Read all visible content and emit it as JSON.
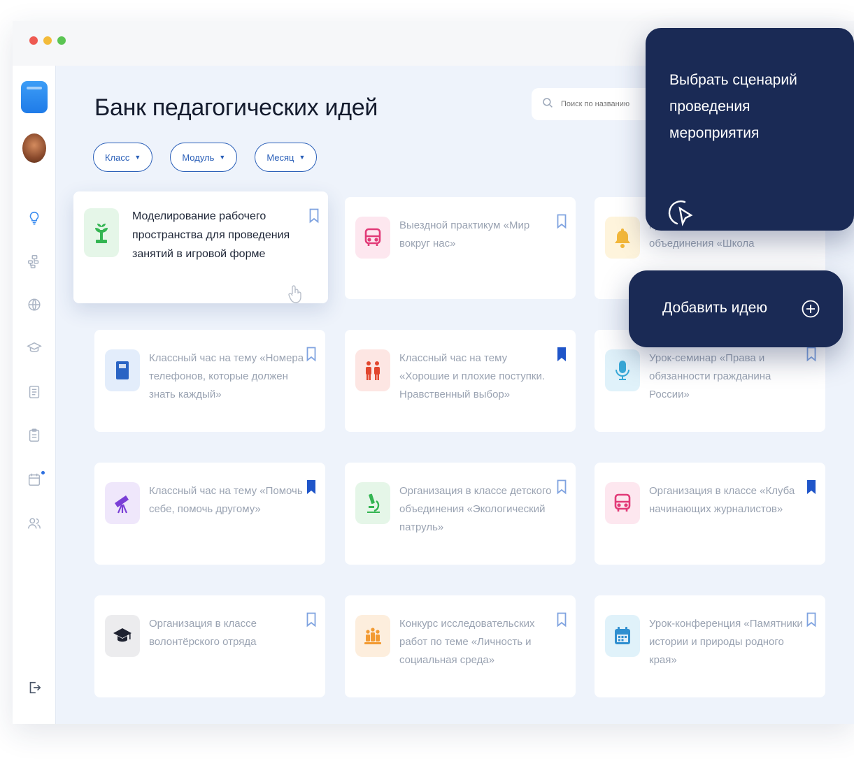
{
  "app": {
    "title": "Банк педагогических идей"
  },
  "search": {
    "placeholder": "Поиск по названию"
  },
  "filters": [
    {
      "label": "Класс"
    },
    {
      "label": "Модуль"
    },
    {
      "label": "Месяц"
    }
  ],
  "sidebar": {
    "items": [
      {
        "icon": "lightbulb-icon",
        "active": true
      },
      {
        "icon": "tree-icon"
      },
      {
        "icon": "globe-icon"
      },
      {
        "icon": "graduation-cap-icon"
      },
      {
        "icon": "document-icon"
      },
      {
        "icon": "clipboard-icon"
      },
      {
        "icon": "calendar-icon",
        "notification": true
      },
      {
        "icon": "users-icon"
      }
    ],
    "logout_icon": "logout-icon"
  },
  "cards": [
    {
      "text": "Моделирование рабочего пространства для проведения занятий в игровой форме",
      "icon": "plant-icon",
      "icon_bg": "#e5f6e8",
      "icon_color": "#34b552",
      "bookmarked": false
    },
    {
      "text": "Выездной практикум «Мир вокруг нас»",
      "icon": "bus-icon",
      "icon_bg": "#fde7ef",
      "icon_color": "#e23b78",
      "bookmarked": false
    },
    {
      "text": "профильного детского объединения «Школа",
      "icon": "bell-icon",
      "icon_bg": "#fef4dc",
      "icon_color": "#f2b73a",
      "bookmarked": false
    },
    {
      "text": "Классный час на тему «Номера телефонов, которые должен знать каждый»",
      "icon": "phonebook-icon",
      "icon_bg": "#e3edfb",
      "icon_color": "#2a64c4",
      "bookmarked": false
    },
    {
      "text": "Классный час на тему «Хорошие и плохие поступки. Нравственный выбор»",
      "icon": "people-icon",
      "icon_bg": "#fde6e3",
      "icon_color": "#e2462e",
      "bookmarked": true
    },
    {
      "text": "Урок-семинар «Права и обязанности гражданина России»",
      "icon": "microphone-icon",
      "icon_bg": "#e0f2fa",
      "icon_color": "#38a9d8",
      "bookmarked": false
    },
    {
      "text": "Классный час на тему «Помочь себе, помочь другому»",
      "icon": "telescope-icon",
      "icon_bg": "#efe7fb",
      "icon_color": "#7a3fd6",
      "bookmarked": true
    },
    {
      "text": "Организация в классе детского объединения «Экологический патруль»",
      "icon": "microscope-icon",
      "icon_bg": "#e5f6e8",
      "icon_color": "#34b552",
      "bookmarked": false
    },
    {
      "text": "Организация в классе «Клуба начинающих журналистов»",
      "icon": "bus-icon",
      "icon_bg": "#fde7ef",
      "icon_color": "#e23b78",
      "bookmarked": true
    },
    {
      "text": "Организация в классе волонтёрского отряда",
      "icon": "graduation-cap-icon",
      "icon_bg": "#ececee",
      "icon_color": "#1e2230",
      "bookmarked": false
    },
    {
      "text": "Конкурс исследовательских работ по теме «Личность и социальная среда»",
      "icon": "team-icon",
      "icon_bg": "#fdeedd",
      "icon_color": "#f29a32",
      "bookmarked": false
    },
    {
      "text": "Урок-конференция «Памятники истории и природы родного края»",
      "icon": "calendar-icon",
      "icon_bg": "#e0f2fa",
      "icon_color": "#2f8fd0",
      "bookmarked": false
    }
  ],
  "popups": {
    "choose_scenario": "Выбрать сценарий проведения мероприятия",
    "add_idea": "Добавить идею"
  },
  "colors": {
    "accent": "#2a5fb8",
    "popup_bg": "#1a2a55",
    "bookmark_filled": "#1f55c9",
    "bookmark_outline": "#7fa3e0"
  }
}
